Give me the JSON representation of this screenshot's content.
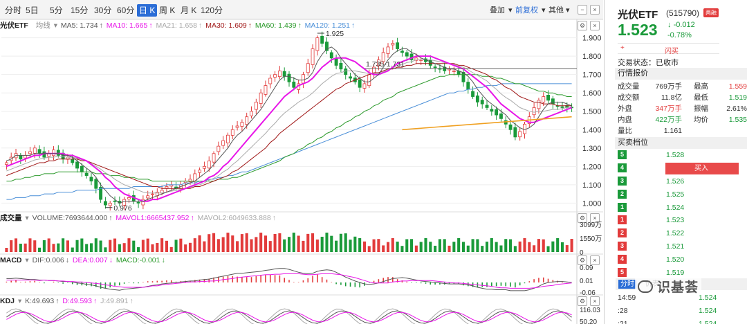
{
  "toolbar": {
    "periods": [
      "分时",
      "5日",
      "5分",
      "15分",
      "30分",
      "60分",
      "日 K",
      "周 K",
      "月 K",
      "120分"
    ],
    "active_period": "日 K",
    "overlay_label": "叠加",
    "adjust_label": "前复权",
    "other_label": "其他"
  },
  "main_legend": {
    "title": "光伏ETF",
    "type": "均线",
    "ma5": "MA5: 1.734",
    "ma10": "MA10: 1.665",
    "ma21": "MA21: 1.658",
    "ma30": "MA30: 1.609",
    "ma60": "MA60: 1.439",
    "ma120": "MA120: 1.251"
  },
  "volume_legend": {
    "title": "成交量",
    "volume": "VOLUME:7693644.000",
    "mavol1": "MAVOL1:6665437.952",
    "mavol2": "MAVOL2:6049633.888"
  },
  "macd_legend": {
    "title": "MACD",
    "dif": "DIF:0.006",
    "dea": "DEA:0.007",
    "macd": "MACD:-0.001"
  },
  "kdj_legend": {
    "title": "KDJ",
    "k": "K:49.693",
    "d": "D:49.593",
    "j": "J:49.891"
  },
  "chart_data": [
    {
      "type": "line",
      "title": "",
      "ylabel": "",
      "y_ticks": [
        "1.900",
        "1.800",
        "1.700",
        "1.600",
        "1.500",
        "1.400",
        "1.300",
        "1.200",
        "1.100",
        "1.000"
      ],
      "ylim": [
        0.96,
        1.94
      ],
      "annotations": [
        "1.925",
        "0.976",
        "1.735-1.731"
      ],
      "annotation_values": [
        1.925,
        0.976,
        1.733
      ],
      "closes": [
        1.22,
        1.25,
        1.27,
        1.24,
        1.26,
        1.28,
        1.3,
        1.27,
        1.25,
        1.27,
        1.29,
        1.26,
        1.24,
        1.25,
        1.22,
        1.19,
        1.17,
        1.15,
        1.12,
        1.08,
        1.02,
        0.99,
        1.0,
        1.01,
        1.0,
        1.02,
        1.03,
        1.01,
        1.0,
        1.02,
        1.04,
        1.05,
        1.06,
        1.07,
        1.09,
        1.1,
        1.08,
        1.1,
        1.12,
        1.13,
        1.16,
        1.18,
        1.2,
        1.23,
        1.27,
        1.31,
        1.34,
        1.37,
        1.4,
        1.42,
        1.44,
        1.47,
        1.5,
        1.55,
        1.6,
        1.64,
        1.68,
        1.7,
        1.72,
        1.69,
        1.66,
        1.63,
        1.65,
        1.7,
        1.76,
        1.84,
        1.9,
        1.87,
        1.83,
        1.79,
        1.75,
        1.73,
        1.7,
        1.68,
        1.66,
        1.63,
        1.65,
        1.7,
        1.74,
        1.78,
        1.82,
        1.85,
        1.87,
        1.84,
        1.82,
        1.8,
        1.78,
        1.79,
        1.78,
        1.77,
        1.75,
        1.74,
        1.73,
        1.72,
        1.73,
        1.72,
        1.7,
        1.66,
        1.62,
        1.58,
        1.55,
        1.54,
        1.52,
        1.5,
        1.48,
        1.46,
        1.43,
        1.4,
        1.36,
        1.39,
        1.43,
        1.47,
        1.52,
        1.56,
        1.58,
        1.56,
        1.54,
        1.53,
        1.52,
        1.52,
        1.52
      ],
      "ma5": [
        1.23,
        1.24,
        1.26,
        1.26,
        1.26,
        1.26,
        1.27,
        1.27,
        1.27,
        1.27,
        1.27,
        1.27,
        1.26,
        1.26,
        1.25,
        1.23,
        1.21,
        1.19,
        1.17,
        1.14,
        1.1,
        1.07,
        1.04,
        1.02,
        1.0,
        1.01,
        1.01,
        1.01,
        1.01,
        1.01,
        1.02,
        1.03,
        1.04,
        1.05,
        1.06,
        1.07,
        1.08,
        1.09,
        1.1,
        1.11,
        1.12,
        1.14,
        1.16,
        1.18,
        1.21,
        1.24,
        1.27,
        1.3,
        1.34,
        1.37,
        1.39,
        1.42,
        1.45,
        1.48,
        1.51,
        1.55,
        1.59,
        1.63,
        1.67,
        1.69,
        1.69,
        1.68,
        1.67,
        1.67,
        1.68,
        1.71,
        1.77,
        1.81,
        1.84,
        1.85,
        1.83,
        1.79,
        1.76,
        1.73,
        1.7,
        1.68,
        1.66,
        1.66,
        1.68,
        1.7,
        1.74,
        1.78,
        1.81,
        1.83,
        1.84,
        1.84,
        1.82,
        1.81,
        1.79,
        1.78,
        1.77,
        1.76,
        1.75,
        1.74,
        1.73,
        1.73,
        1.72,
        1.71,
        1.69,
        1.66,
        1.62,
        1.59,
        1.56,
        1.54,
        1.52,
        1.5,
        1.48,
        1.45,
        1.43,
        1.41,
        1.4,
        1.41,
        1.43,
        1.47,
        1.51,
        1.54,
        1.55,
        1.55,
        1.55,
        1.54,
        1.53
      ],
      "ma10": [
        1.2,
        1.21,
        1.22,
        1.23,
        1.24,
        1.25,
        1.26,
        1.26,
        1.27,
        1.27,
        1.27,
        1.27,
        1.27,
        1.26,
        1.26,
        1.25,
        1.24,
        1.23,
        1.21,
        1.19,
        1.17,
        1.14,
        1.12,
        1.09,
        1.07,
        1.05,
        1.04,
        1.03,
        1.02,
        1.01,
        1.01,
        1.02,
        1.02,
        1.03,
        1.04,
        1.05,
        1.06,
        1.07,
        1.08,
        1.09,
        1.1,
        1.11,
        1.12,
        1.14,
        1.15,
        1.17,
        1.2,
        1.22,
        1.25,
        1.28,
        1.31,
        1.34,
        1.37,
        1.4,
        1.43,
        1.46,
        1.49,
        1.52,
        1.55,
        1.58,
        1.6,
        1.62,
        1.64,
        1.65,
        1.66,
        1.68,
        1.71,
        1.74,
        1.76,
        1.78,
        1.79,
        1.79,
        1.79,
        1.78,
        1.77,
        1.75,
        1.73,
        1.71,
        1.7,
        1.7,
        1.71,
        1.72,
        1.74,
        1.76,
        1.77,
        1.78,
        1.79,
        1.8,
        1.8,
        1.8,
        1.8,
        1.79,
        1.78,
        1.77,
        1.76,
        1.75,
        1.74,
        1.73,
        1.71,
        1.69,
        1.67,
        1.65,
        1.63,
        1.6,
        1.57,
        1.54,
        1.52,
        1.5,
        1.48,
        1.46,
        1.45,
        1.44,
        1.44,
        1.45,
        1.46,
        1.47,
        1.48,
        1.49,
        1.5,
        1.51,
        1.52
      ],
      "ma30": [
        1.15,
        1.16,
        1.17,
        1.18,
        1.19,
        1.2,
        1.21,
        1.22,
        1.22,
        1.23,
        1.23,
        1.24,
        1.24,
        1.24,
        1.24,
        1.24,
        1.23,
        1.23,
        1.22,
        1.21,
        1.2,
        1.19,
        1.18,
        1.17,
        1.16,
        1.15,
        1.14,
        1.13,
        1.12,
        1.11,
        1.1,
        1.09,
        1.09,
        1.08,
        1.08,
        1.08,
        1.08,
        1.08,
        1.08,
        1.08,
        1.09,
        1.09,
        1.1,
        1.11,
        1.12,
        1.13,
        1.14,
        1.15,
        1.17,
        1.18,
        1.2,
        1.22,
        1.24,
        1.26,
        1.28,
        1.3,
        1.33,
        1.35,
        1.38,
        1.4,
        1.42,
        1.44,
        1.46,
        1.48,
        1.5,
        1.52,
        1.54,
        1.56,
        1.58,
        1.6,
        1.62,
        1.63,
        1.65,
        1.66,
        1.67,
        1.68,
        1.69,
        1.7,
        1.71,
        1.71,
        1.72,
        1.73,
        1.73,
        1.74,
        1.74,
        1.75,
        1.75,
        1.76,
        1.76,
        1.76,
        1.76,
        1.76,
        1.76,
        1.76,
        1.76,
        1.76,
        1.75,
        1.75,
        1.74,
        1.73,
        1.72,
        1.71,
        1.7,
        1.68,
        1.67,
        1.65,
        1.63,
        1.62,
        1.6,
        1.58,
        1.57,
        1.56,
        1.55,
        1.55,
        1.54,
        1.54,
        1.54,
        1.53,
        1.53,
        1.53,
        1.53
      ],
      "ma60": [
        1.12,
        1.12,
        1.13,
        1.13,
        1.14,
        1.14,
        1.15,
        1.15,
        1.16,
        1.16,
        1.16,
        1.17,
        1.17,
        1.17,
        1.17,
        1.17,
        1.17,
        1.17,
        1.17,
        1.16,
        1.16,
        1.16,
        1.15,
        1.15,
        1.15,
        1.14,
        1.14,
        1.14,
        1.13,
        1.13,
        1.13,
        1.12,
        1.12,
        1.12,
        1.12,
        1.12,
        1.12,
        1.12,
        1.12,
        1.12,
        1.12,
        1.12,
        1.12,
        1.12,
        1.12,
        1.13,
        1.13,
        1.13,
        1.14,
        1.14,
        1.15,
        1.16,
        1.17,
        1.18,
        1.19,
        1.2,
        1.21,
        1.22,
        1.23,
        1.25,
        1.26,
        1.27,
        1.29,
        1.3,
        1.32,
        1.33,
        1.35,
        1.36,
        1.38,
        1.39,
        1.41,
        1.42,
        1.44,
        1.45,
        1.47,
        1.48,
        1.5,
        1.51,
        1.53,
        1.54,
        1.56,
        1.57,
        1.58,
        1.6,
        1.61,
        1.62,
        1.63,
        1.64,
        1.65,
        1.66,
        1.67,
        1.68,
        1.69,
        1.69,
        1.7,
        1.7,
        1.7,
        1.7,
        1.7,
        1.7,
        1.7,
        1.69,
        1.69,
        1.69,
        1.68,
        1.68,
        1.67,
        1.66,
        1.65,
        1.65,
        1.64,
        1.63,
        1.62,
        1.61,
        1.61,
        1.6,
        1.6,
        1.59,
        1.59,
        1.58,
        1.58
      ],
      "ma120": [
        1.02,
        1.02,
        1.03,
        1.03,
        1.03,
        1.04,
        1.04,
        1.04,
        1.05,
        1.05,
        1.05,
        1.06,
        1.06,
        1.06,
        1.06,
        1.07,
        1.07,
        1.07,
        1.07,
        1.07,
        1.08,
        1.08,
        1.08,
        1.08,
        1.08,
        1.08,
        1.08,
        1.09,
        1.09,
        1.09,
        1.09,
        1.09,
        1.09,
        1.09,
        1.1,
        1.1,
        1.1,
        1.1,
        1.11,
        1.11,
        1.11,
        1.12,
        1.12,
        1.13,
        1.13,
        1.14,
        1.14,
        1.15,
        1.15,
        1.16,
        1.17,
        1.17,
        1.18,
        1.19,
        1.2,
        1.21,
        1.22,
        1.23,
        1.24,
        1.25,
        1.26,
        1.27,
        1.28,
        1.29,
        1.3,
        1.31,
        1.32,
        1.33,
        1.34,
        1.35,
        1.36,
        1.37,
        1.38,
        1.39,
        1.4,
        1.41,
        1.42,
        1.43,
        1.44,
        1.45,
        1.46,
        1.47,
        1.48,
        1.49,
        1.5,
        1.51,
        1.52,
        1.53,
        1.54,
        1.55,
        1.56,
        1.57,
        1.58,
        1.59,
        1.6,
        1.6,
        1.61,
        1.61,
        1.62,
        1.62,
        1.63,
        1.63,
        1.64,
        1.64,
        1.64,
        1.65,
        1.65,
        1.65,
        1.65,
        1.65,
        1.65,
        1.65,
        1.65,
        1.65,
        1.65,
        1.65,
        1.65,
        1.65,
        1.65,
        1.65,
        1.65
      ],
      "trendline": [
        1.4,
        1.47
      ]
    },
    {
      "type": "bar",
      "title": "成交量",
      "y_ticks": [
        "3099万",
        "1550万",
        "0"
      ]
    },
    {
      "type": "bar",
      "title": "MACD",
      "y_ticks": [
        "0.09",
        "0.01",
        "-0.06"
      ]
    },
    {
      "type": "line",
      "title": "KDJ",
      "y_ticks": [
        "116.03",
        "50.20"
      ]
    }
  ],
  "quote": {
    "name": "光伏ETF",
    "code": "(515790)",
    "badge": "两融",
    "price": "1.523",
    "change": "-0.012",
    "change_pct": "-0.78%",
    "flash_label": "闪买",
    "status": "交易状态：已收市",
    "section_quote": "行情报价",
    "rows": [
      {
        "l1": "成交量",
        "v1": "769万手",
        "l2": "最高",
        "v2": "1.559",
        "c2": "red"
      },
      {
        "l1": "成交额",
        "v1": "11.8亿",
        "l2": "最低",
        "v2": "1.519",
        "c2": "green"
      },
      {
        "l1": "外盘",
        "v1": "347万手",
        "c1": "red",
        "l2": "振幅",
        "v2": "2.61%"
      },
      {
        "l1": "内盘",
        "v1": "422万手",
        "c1": "green",
        "l2": "均价",
        "v2": "1.535",
        "c2": "green"
      },
      {
        "l1": "量比",
        "v1": "1.161"
      }
    ],
    "section_orderbook": "买卖档位",
    "asks": [
      {
        "idx": "5",
        "price": "1.528"
      },
      {
        "idx": "4",
        "price": "1.527"
      },
      {
        "idx": "3",
        "price": "1.526"
      },
      {
        "idx": "2",
        "price": "1.525"
      },
      {
        "idx": "1",
        "price": "1.524"
      }
    ],
    "bids": [
      {
        "idx": "1",
        "price": "1.523"
      },
      {
        "idx": "2",
        "price": "1.522"
      },
      {
        "idx": "3",
        "price": "1.521"
      },
      {
        "idx": "4",
        "price": "1.520"
      },
      {
        "idx": "5",
        "price": "1.519"
      }
    ],
    "buy_label": "买入",
    "tick_tab": "分时",
    "tick_tab2": "价表",
    "ticks": [
      {
        "time": "14:59",
        "price": "1.524"
      },
      {
        "time": ":28",
        "price": "1.524"
      },
      {
        "time": ":21",
        "price": "1.524"
      }
    ]
  },
  "watermark": "识基荟",
  "colors": {
    "up": "#e23b3b",
    "down": "#1a9a3a",
    "ma5": "#555555",
    "ma10": "#e815e8",
    "ma21": "#aaaaaa",
    "ma30": "#a01818",
    "ma60": "#2e9b2e",
    "ma120": "#4a8fd8",
    "trend": "#f0a020"
  }
}
